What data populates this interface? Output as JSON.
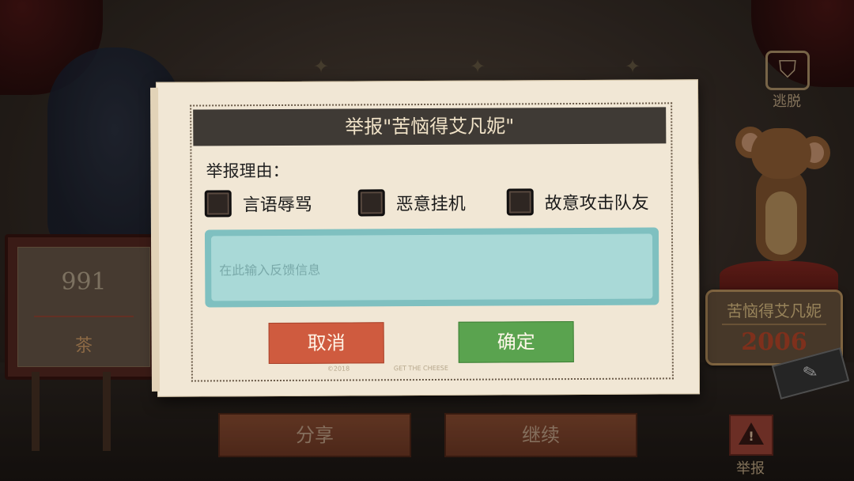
{
  "background": {
    "escape": {
      "icon": "escape-icon",
      "label": "逃脱"
    },
    "left_board": {
      "score": "991",
      "name": "茶"
    },
    "player_plate": {
      "name": "苦恼得艾凡妮",
      "score": "2006"
    },
    "bottom_buttons": {
      "share": "分享",
      "continue": "继续"
    },
    "report": {
      "icon": "warning-icon",
      "label": "举报"
    }
  },
  "dialog": {
    "title": "举报\"苦恼得艾凡妮\"",
    "reason_label": "举报理由：",
    "options": [
      {
        "label": "言语辱骂",
        "checked": false
      },
      {
        "label": "恶意挂机",
        "checked": false
      },
      {
        "label": "故意攻击队友",
        "checked": false
      }
    ],
    "feedback": {
      "placeholder": "在此输入反馈信息",
      "value": ""
    },
    "cancel_label": "取消",
    "confirm_label": "确定",
    "fine_print": [
      "©2018",
      "GET THE CHEESE"
    ]
  },
  "colors": {
    "cancel": "#cf5b3f",
    "confirm": "#5aa34f",
    "title_bar": "#3f3a35",
    "textarea": "#a9d9d7"
  }
}
